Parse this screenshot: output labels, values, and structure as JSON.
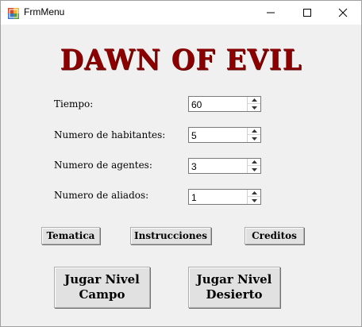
{
  "window": {
    "title": "FrmMenu",
    "icon": "winforms-app-icon",
    "controls": [
      "minimize-icon",
      "maximize-icon",
      "close-icon"
    ]
  },
  "game": {
    "title": "DAWN OF EVIL",
    "title_color": "#8b0000"
  },
  "fields": [
    {
      "label": "Tiempo:",
      "value": "60"
    },
    {
      "label": "Numero de habitantes:",
      "value": "5"
    },
    {
      "label": "Numero de agentes:",
      "value": "3"
    },
    {
      "label": "Numero de aliados:",
      "value": "1"
    }
  ],
  "buttons": {
    "tematica": "Tematica",
    "instrucciones": "Instrucciones",
    "creditos": "Creditos",
    "jugar_campo": "Jugar Nivel\nCampo",
    "jugar_desierto": "Jugar Nivel\nDesierto"
  }
}
